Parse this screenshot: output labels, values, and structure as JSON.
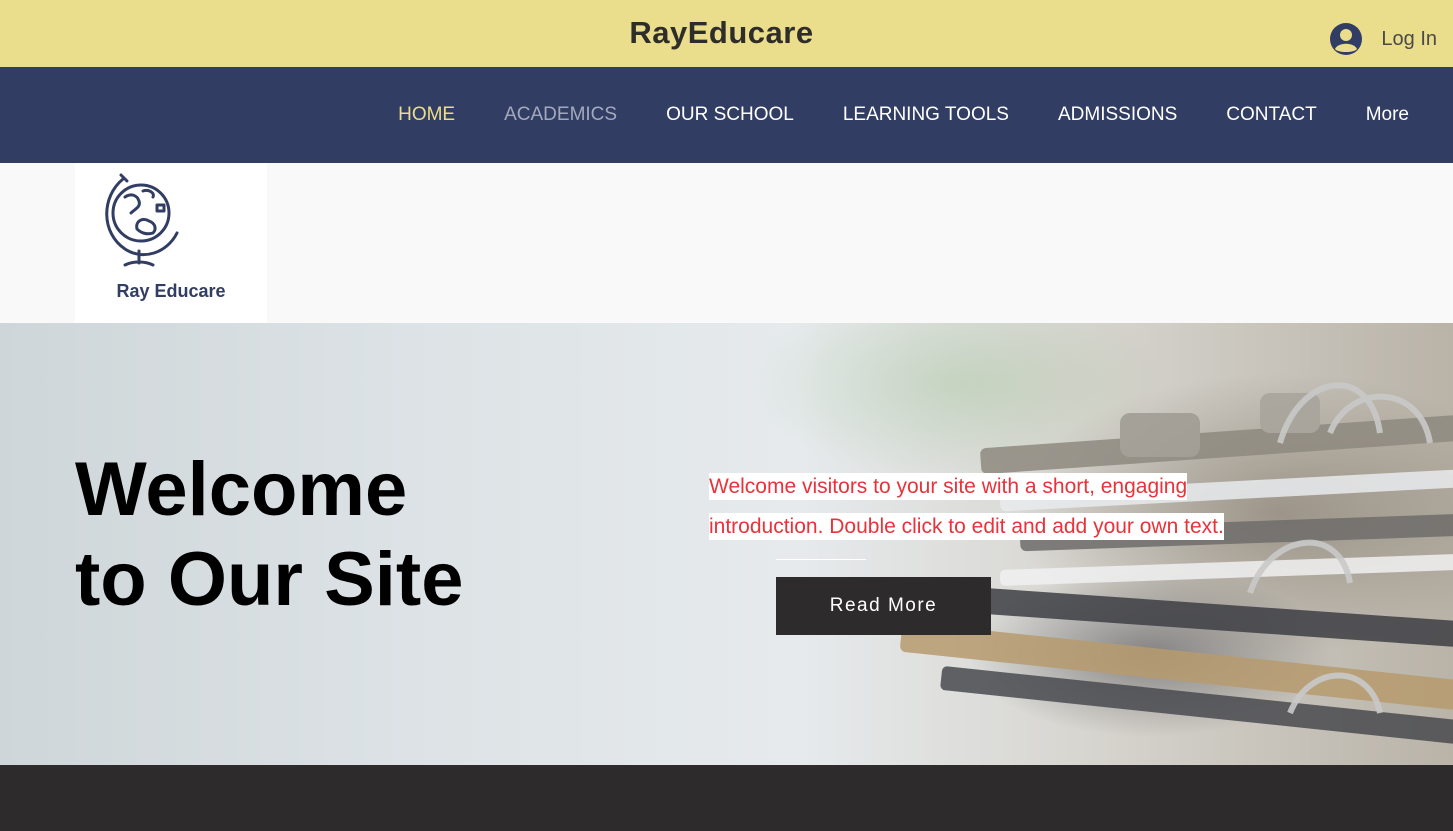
{
  "header": {
    "site_title": "RayEducare",
    "login_label": "Log In",
    "login_icon": "user-avatar-icon"
  },
  "nav": {
    "items": [
      {
        "label": "HOME",
        "state": "active"
      },
      {
        "label": "ACADEMICS",
        "state": "hover"
      },
      {
        "label": "OUR SCHOOL",
        "state": "normal"
      },
      {
        "label": "LEARNING TOOLS",
        "state": "normal"
      },
      {
        "label": "ADMISSIONS",
        "state": "normal"
      },
      {
        "label": "CONTACT",
        "state": "normal"
      },
      {
        "label": "More",
        "state": "normal"
      }
    ]
  },
  "logo": {
    "icon": "globe-icon",
    "name": "Ray Educare"
  },
  "hero": {
    "title_line1": "Welcome",
    "title_line2": "to Our Site",
    "intro": "Welcome visitors to your site with a short, engaging introduction. Double click to edit and add your own text.",
    "button_label": "Read More"
  },
  "colors": {
    "topbar": "#eadd8c",
    "navbar": "#323d63",
    "nav_active": "#eadd8c",
    "intro_text": "#e8333a",
    "button_bg": "#2d2b2c",
    "footer": "#2d2b2c"
  }
}
